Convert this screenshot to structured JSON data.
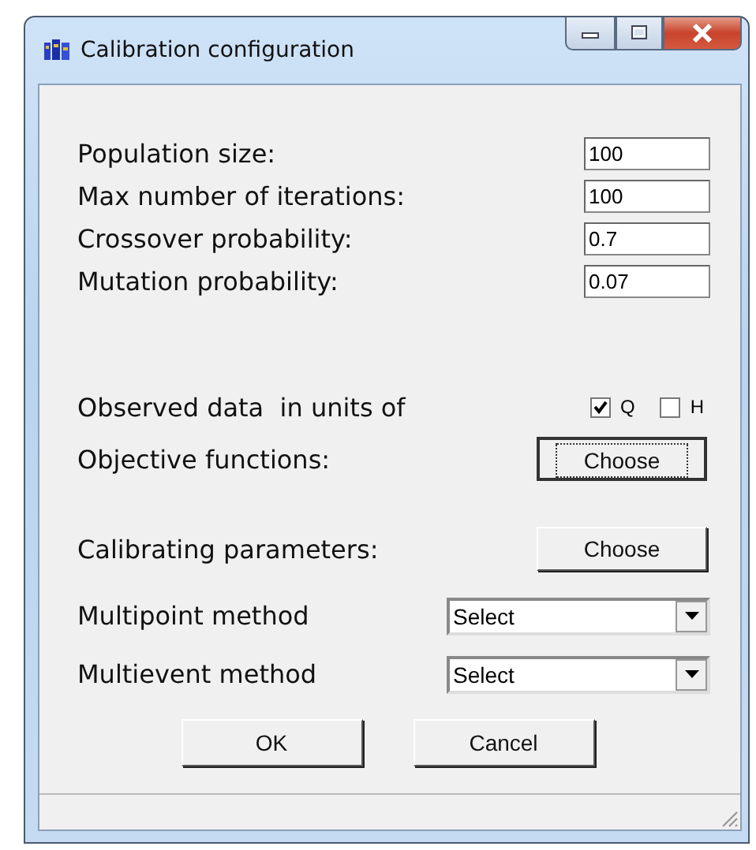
{
  "window": {
    "title": "Calibration configuration"
  },
  "fields": [
    {
      "label": "Population size:",
      "value": "100"
    },
    {
      "label": "Max number of iterations:",
      "value": "100"
    },
    {
      "label": "Crossover probability:",
      "value": "0.7"
    },
    {
      "label": "Mutation probability:",
      "value": "0.07"
    }
  ],
  "observed": {
    "label": "Observed data  in units of",
    "options": [
      {
        "label": "Q",
        "checked": true
      },
      {
        "label": "H",
        "checked": false
      }
    ]
  },
  "choosers": [
    {
      "label": "Objective functions:",
      "button": "Choose",
      "focused": true
    },
    {
      "label": "Calibrating parameters:",
      "button": "Choose",
      "focused": false
    }
  ],
  "dropdowns": [
    {
      "label": "Multipoint method",
      "value": "Select"
    },
    {
      "label": "Multievent method",
      "value": "Select"
    }
  ],
  "buttons": [
    "OK",
    "Cancel"
  ]
}
